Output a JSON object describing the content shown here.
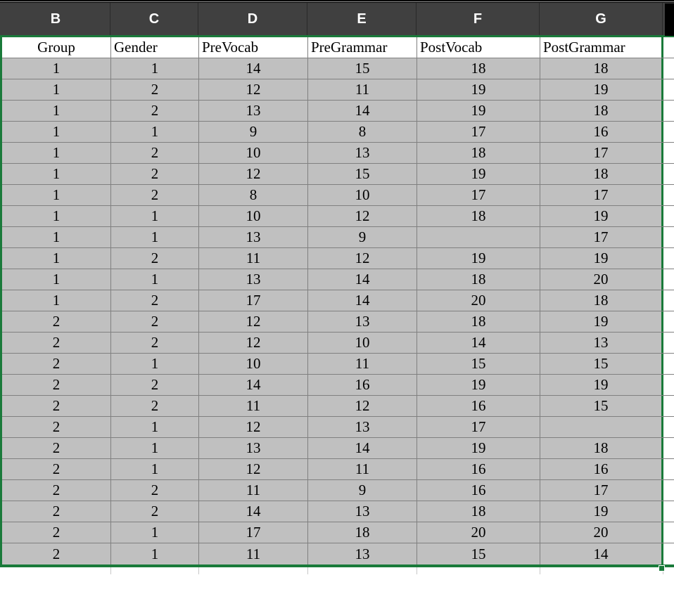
{
  "columns": [
    "B",
    "C",
    "D",
    "E",
    "F",
    "G"
  ],
  "fields": [
    "Group",
    "Gender",
    "PreVocab",
    "PreGrammar",
    "PostVocab",
    "PostGrammar"
  ],
  "rows": [
    [
      "1",
      "1",
      "14",
      "15",
      "18",
      "18"
    ],
    [
      "1",
      "2",
      "12",
      "11",
      "19",
      "19"
    ],
    [
      "1",
      "2",
      "13",
      "14",
      "19",
      "18"
    ],
    [
      "1",
      "1",
      "9",
      "8",
      "17",
      "16"
    ],
    [
      "1",
      "2",
      "10",
      "13",
      "18",
      "17"
    ],
    [
      "1",
      "2",
      "12",
      "15",
      "19",
      "18"
    ],
    [
      "1",
      "2",
      "8",
      "10",
      "17",
      "17"
    ],
    [
      "1",
      "1",
      "10",
      "12",
      "18",
      "19"
    ],
    [
      "1",
      "1",
      "13",
      "9",
      "",
      "17"
    ],
    [
      "1",
      "2",
      "11",
      "12",
      "19",
      "19"
    ],
    [
      "1",
      "1",
      "13",
      "14",
      "18",
      "20"
    ],
    [
      "1",
      "2",
      "17",
      "14",
      "20",
      "18"
    ],
    [
      "2",
      "2",
      "12",
      "13",
      "18",
      "19"
    ],
    [
      "2",
      "2",
      "12",
      "10",
      "14",
      "13"
    ],
    [
      "2",
      "1",
      "10",
      "11",
      "15",
      "15"
    ],
    [
      "2",
      "2",
      "14",
      "16",
      "19",
      "19"
    ],
    [
      "2",
      "2",
      "11",
      "12",
      "16",
      "15"
    ],
    [
      "2",
      "1",
      "12",
      "13",
      "17",
      ""
    ],
    [
      "2",
      "1",
      "13",
      "14",
      "19",
      "18"
    ],
    [
      "2",
      "1",
      "12",
      "11",
      "16",
      "16"
    ],
    [
      "2",
      "2",
      "11",
      "9",
      "16",
      "17"
    ],
    [
      "2",
      "2",
      "14",
      "13",
      "18",
      "19"
    ],
    [
      "2",
      "1",
      "17",
      "18",
      "20",
      "20"
    ],
    [
      "2",
      "1",
      "11",
      "13",
      "15",
      "14"
    ]
  ],
  "colors": {
    "selection_border": "#1a7a3a",
    "header_bg": "#404040",
    "cell_bg": "#c0c0c0"
  }
}
